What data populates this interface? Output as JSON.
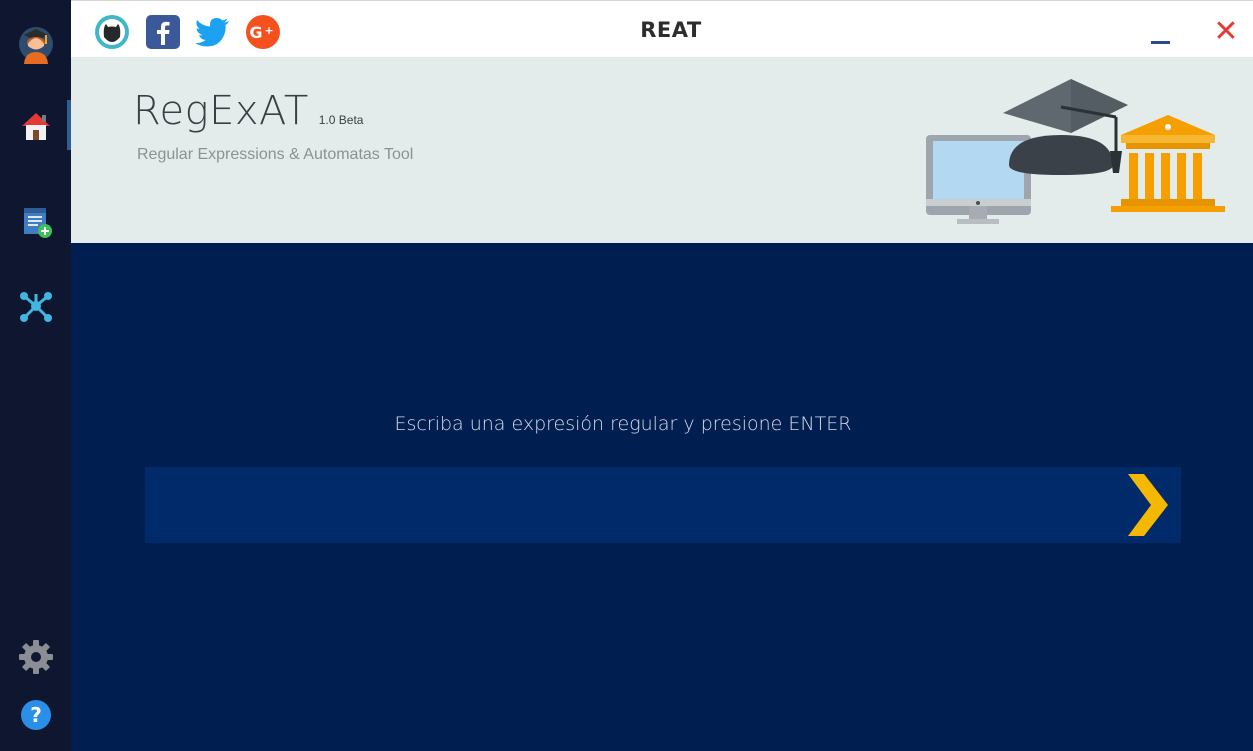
{
  "titlebar": {
    "title": "REAT",
    "social": [
      {
        "icon": "github-icon",
        "color": "#24292e"
      },
      {
        "icon": "facebook-icon",
        "color": "#3b5998"
      },
      {
        "icon": "twitter-icon",
        "color": "#1da1f2"
      },
      {
        "icon": "google-plus-icon",
        "color": "#f4511e"
      }
    ]
  },
  "sidebar": {
    "items": [
      {
        "icon": "user-avatar-icon"
      },
      {
        "icon": "home-icon",
        "active": true
      },
      {
        "icon": "add-document-icon"
      },
      {
        "icon": "graph-network-icon"
      },
      {
        "icon": "gear-icon"
      },
      {
        "icon": "help-icon"
      }
    ]
  },
  "banner": {
    "name": "RegExAT",
    "version": "1.0 Beta",
    "subtitle": "Regular Expressions & Automatas Tool"
  },
  "main": {
    "prompt": "Escriba una expresión regular y presione ENTER",
    "input_value": "",
    "submit_icon": "chevron-right-icon"
  },
  "colors": {
    "sidebar_bg": "#0f1730",
    "main_bg": "#001e4f",
    "input_bg": "#012a6b",
    "banner_bg": "#e4eceb",
    "accent_yellow": "#f5b800",
    "close_red": "#e53935"
  }
}
